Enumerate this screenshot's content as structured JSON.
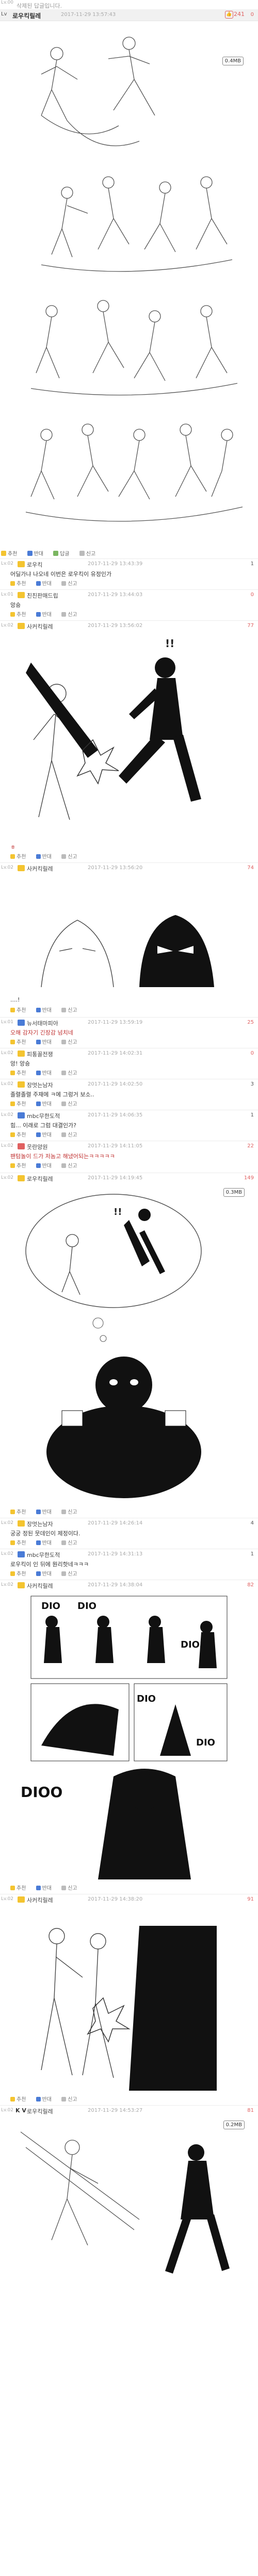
{
  "top": {
    "notice": "삭제된 답글입니다.",
    "level": "Lv.00"
  },
  "post1": {
    "level": "Lv",
    "nick": "로우킥릴레",
    "time": "2017-11-29 13:57:43",
    "votes": "241",
    "score": "0",
    "size": "0.4MB",
    "actions": {
      "recommend": "추천",
      "oppose": "반대",
      "reply": "답글",
      "report": "신고"
    }
  },
  "comments": [
    {
      "level": "Lv.02",
      "nick": "로우킥",
      "time": "2017-11-29 13:43:39",
      "score": "1",
      "body": "어딜가냐 나오네 이번은 로우킥이 유정인가",
      "actions": [
        "추천",
        "반대",
        "신고"
      ]
    },
    {
      "level": "Lv.01",
      "nick": "친친판매드립",
      "time": "2017-11-29 13:44:03",
      "score": "0",
      "body": "앙숑",
      "actions": [
        "추천",
        "반대",
        "신고"
      ]
    },
    {
      "level": "Lv.02",
      "nick": "사커킥릴레",
      "time": "2017-11-29 13:56:02",
      "score": "77",
      "body": "ㅎ",
      "actions": [
        "추천",
        "반대",
        "신고"
      ]
    },
    {
      "level": "Lv.02",
      "nick": "사커킥릴레",
      "time": "2017-11-29 13:56:20",
      "score": "74",
      "body": "....!",
      "actions": [
        "추천",
        "반대",
        "신고"
      ]
    },
    {
      "level": "Lv.01",
      "nick": "뉴서태마피아",
      "time": "2017-11-29 13:59:19",
      "score": "25",
      "body": "오해 감자기 긴장감 넘치네",
      "actions": [
        "추천",
        "반대",
        "신고"
      ]
    },
    {
      "level": "Lv.02",
      "nick": "피통꼴전쟁",
      "time": "2017-11-29 14:02:31",
      "score": "0",
      "body": "앙! 앙숑",
      "actions": [
        "추천",
        "반대",
        "신고"
      ]
    },
    {
      "level": "Lv.02",
      "nick": "장멋는남자",
      "time": "2017-11-29 14:02:50",
      "score": "3",
      "body": "졸렬졸렬 주재에 ㅋ에 그렁거 보소..",
      "actions": [
        "추천",
        "반대",
        "신고"
      ]
    },
    {
      "level": "Lv.02",
      "nick": "mbc무한도적",
      "time": "2017-11-29 14:06:35",
      "score": "1",
      "body": "힘... 이래로 그럼 대결인가?",
      "actions": [
        "추천",
        "반대",
        "신고"
      ]
    },
    {
      "level": "Lv.02",
      "nick": "웃란양원",
      "time": "2017-11-29 14:11:05",
      "score": "22",
      "body": "팬텀놀이 드가 저놈고 해냈어되는ㅋㅋㅋㅋㅋ",
      "actions": [
        "추천",
        "반대",
        "신고"
      ]
    }
  ],
  "post2": {
    "level": "Lv.02",
    "nick": "로우킥릴레",
    "time": "2017-11-29 14:19:45",
    "score": "149",
    "size": "0.3MB",
    "actions": [
      "추천",
      "반대",
      "신고"
    ]
  },
  "comments2": [
    {
      "level": "Lv.02",
      "nick": "장멋는남자",
      "time": "2017-11-29 14:26:14",
      "score": "4",
      "body": "궁궁 정된 뭇데인이 제정이다.",
      "actions": [
        "추천",
        "반대",
        "신고"
      ]
    },
    {
      "level": "Lv.02",
      "nick": "mbc무한도적",
      "time": "2017-11-29 14:31:13",
      "score": "1",
      "body": "로우킥이 인 뒤에 뭔리핫네ㅋㅋㅋ",
      "actions": [
        "추천",
        "반대",
        "신고"
      ]
    },
    {
      "level": "Lv.02",
      "nick": "사커킥릴레",
      "time": "2017-11-29 14:38:04",
      "score": "82",
      "body": "",
      "actions": [
        "추천",
        "반대",
        "신고"
      ]
    }
  ],
  "comic_labels": {
    "dio1": "DIO",
    "dio2": "DIO",
    "dio3": "DIO",
    "dio4": "DIO",
    "dio5": "DIO",
    "dioo": "DIOO"
  },
  "post3": {
    "level": "Lv.02",
    "nick": "사커킥릴레",
    "time": "2017-11-29 14:38:20",
    "score": "91",
    "actions": [
      "추천",
      "반대",
      "신고"
    ]
  },
  "post4": {
    "level": "Lv.02",
    "nick": "로우킥릴레",
    "time": "2017-11-29 14:53:27",
    "score": "81",
    "size": "0.2MB",
    "actions": [
      "추천",
      "반대",
      "신고"
    ]
  },
  "post4_prefix": "K V",
  "colors": {
    "accent": "#e06060",
    "yellow_badge": "#f4c430",
    "blue_badge": "#4a7bd6",
    "gray_bar": "#f3f3f3"
  }
}
